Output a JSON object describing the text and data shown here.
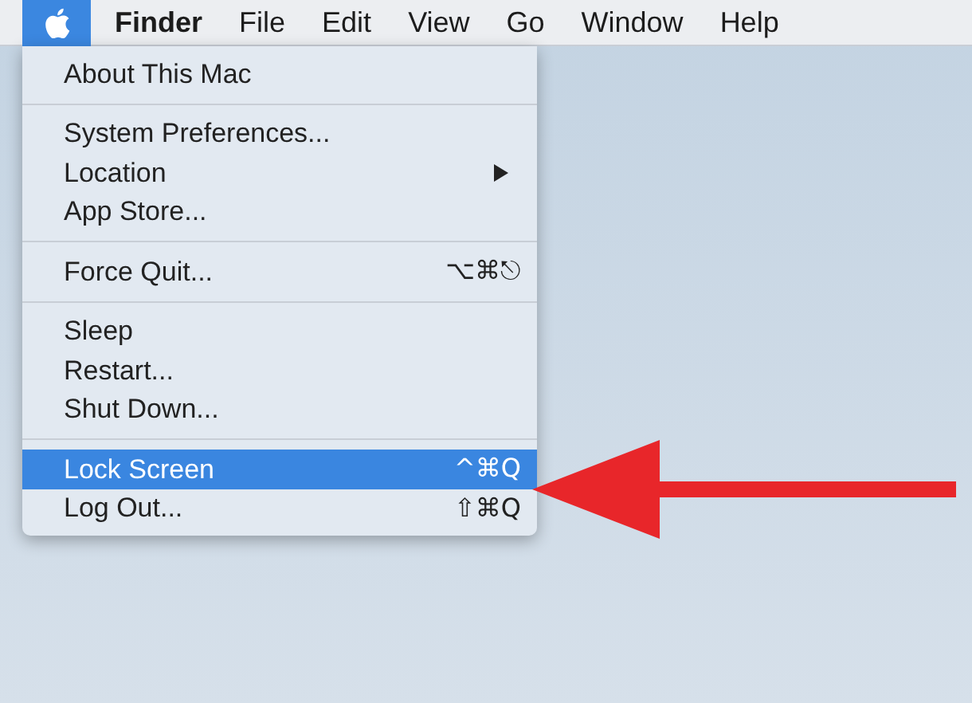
{
  "menu_bar": {
    "apple_menu_open": true,
    "items": [
      {
        "label": "Finder",
        "bold": true
      },
      {
        "label": "File",
        "bold": false
      },
      {
        "label": "Edit",
        "bold": false
      },
      {
        "label": "View",
        "bold": false
      },
      {
        "label": "Go",
        "bold": false
      },
      {
        "label": "Window",
        "bold": false
      },
      {
        "label": "Help",
        "bold": false
      }
    ]
  },
  "apple_menu": {
    "groups": [
      [
        {
          "label": "About This Mac",
          "selected": false,
          "submenu": false
        }
      ],
      [
        {
          "label": "System Preferences...",
          "selected": false,
          "submenu": false
        },
        {
          "label": "Location",
          "selected": false,
          "submenu": true
        },
        {
          "label": "App Store...",
          "selected": false,
          "submenu": false
        }
      ],
      [
        {
          "label": "Force Quit...",
          "shortcut": "⌥⌘⎋",
          "selected": false,
          "submenu": false
        }
      ],
      [
        {
          "label": "Sleep",
          "selected": false,
          "submenu": false
        },
        {
          "label": "Restart...",
          "selected": false,
          "submenu": false
        },
        {
          "label": "Shut Down...",
          "selected": false,
          "submenu": false
        }
      ],
      [
        {
          "label": "Lock Screen",
          "shortcut": "^⌘Q",
          "selected": true,
          "submenu": false
        },
        {
          "label": "Log Out...",
          "shortcut": "⇧⌘Q",
          "selected": false,
          "submenu": false
        }
      ]
    ]
  },
  "annotation": {
    "kind": "arrow"
  }
}
